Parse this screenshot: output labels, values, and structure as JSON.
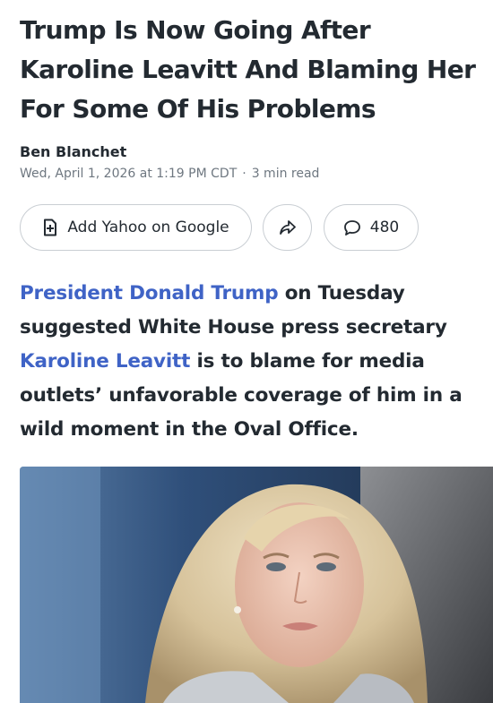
{
  "article": {
    "headline": "Trump Is Now Going After Karoline Leavitt And Blaming Her For Some Of His Problems",
    "author": "Ben Blanchet",
    "date": "Wed, April 1, 2026 at 1:19 PM CDT",
    "separator": "·",
    "read_time": "3 min read"
  },
  "actions": {
    "google_label": "Add Yahoo on Google",
    "google_icon": "plus-box-icon",
    "share_icon": "share-arrow-icon",
    "comment_icon": "speech-bubble-icon",
    "comment_count": "480"
  },
  "lede": {
    "link1": "President Donald Trump",
    "text1": " on Tuesday suggested White House press secretary ",
    "link2": "Karoline Leavitt",
    "text2": " is to blame for media outlets’ unfavorable coverage of him in a wild moment in the Oval Office."
  },
  "colors": {
    "link": "#3f63c6",
    "text": "#232a31",
    "meta": "#6e7780",
    "pill_border": "#c9ced3"
  }
}
